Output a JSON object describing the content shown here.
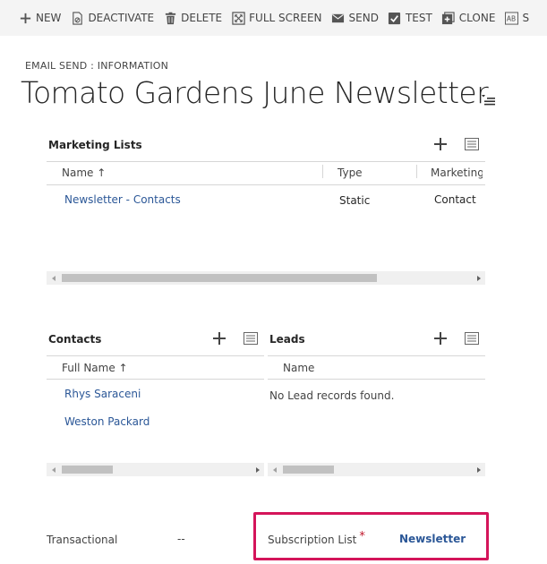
{
  "toolbar": {
    "buttons": [
      {
        "label": "NEW",
        "icon": "plus-icon"
      },
      {
        "label": "DEACTIVATE",
        "icon": "deactivate-icon"
      },
      {
        "label": "DELETE",
        "icon": "trash-icon"
      },
      {
        "label": "FULL SCREEN",
        "icon": "fullscreen-icon"
      },
      {
        "label": "SEND",
        "icon": "envelope-icon"
      },
      {
        "label": "TEST",
        "icon": "checkbox-icon"
      },
      {
        "label": "CLONE",
        "icon": "clone-icon"
      },
      {
        "label": "S",
        "icon": "spellcheck-icon"
      }
    ]
  },
  "header": {
    "breadcrumb": "EMAIL SEND : INFORMATION",
    "title": "Tomato Gardens June Newsletter"
  },
  "marketing_lists": {
    "title": "Marketing Lists",
    "columns": [
      "Name ↑",
      "Type",
      "Marketing"
    ],
    "rows": [
      {
        "name": "Newsletter - Contacts",
        "type": "Static",
        "member": "Contact"
      }
    ]
  },
  "contacts": {
    "title": "Contacts",
    "columns": [
      "Full Name ↑"
    ],
    "rows": [
      "Rhys Saraceni",
      "Weston Packard"
    ]
  },
  "leads": {
    "title": "Leads",
    "columns": [
      "Name"
    ],
    "empty_message": "No Lead records found."
  },
  "fields": {
    "transactional_label": "Transactional",
    "transactional_value": "--",
    "subscription_label": "Subscription List",
    "subscription_required": "*",
    "subscription_value": "Newsletter"
  },
  "colors": {
    "link": "#2b5797",
    "highlight": "#d4145a",
    "required": "#c0172b"
  }
}
